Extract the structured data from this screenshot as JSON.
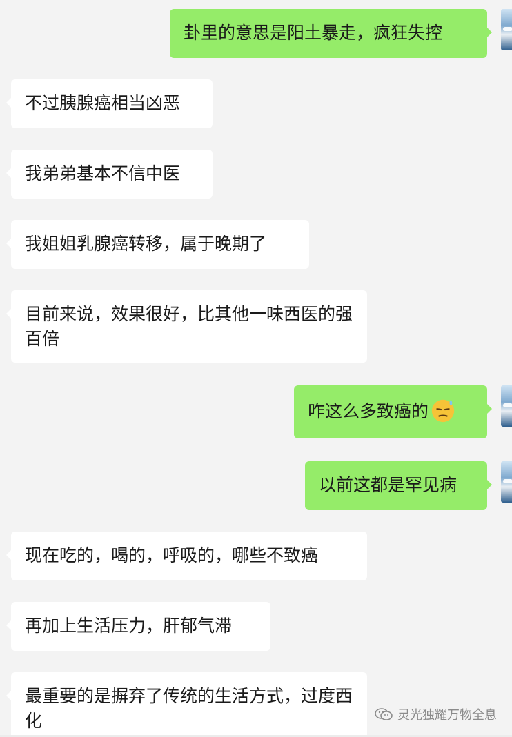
{
  "messages": [
    {
      "side": "out",
      "text": "卦里的意思是阳土暴走，疯狂失控"
    },
    {
      "side": "in",
      "text": "不过胰腺癌相当凶恶"
    },
    {
      "side": "in",
      "text": "我弟弟基本不信中医"
    },
    {
      "side": "in",
      "text": "我姐姐乳腺癌转移，属于晚期了"
    },
    {
      "side": "in",
      "text": "目前来说，效果很好，比其他一味西医的强百倍"
    },
    {
      "side": "out",
      "text": "咋这么多致癌的",
      "emoji": "sweat-smile-emoji"
    },
    {
      "side": "out",
      "text": "以前这都是罕见病"
    },
    {
      "side": "in",
      "text": "现在吃的，喝的，呼吸的，哪些不致癌"
    },
    {
      "side": "in",
      "text": "再加上生活压力，肝郁气滞"
    },
    {
      "side": "in",
      "text": "最重要的是摒弃了传统的生活方式，过度西化"
    }
  ],
  "watermark": {
    "text": "灵光独耀万物全息",
    "icon": "wechat-official-account-icon"
  },
  "colors": {
    "background": "#f3f3f3",
    "incoming_bubble": "#ffffff",
    "outgoing_bubble": "#95ec69",
    "text": "#1a1a1a",
    "watermark": "#8b8b8b"
  }
}
